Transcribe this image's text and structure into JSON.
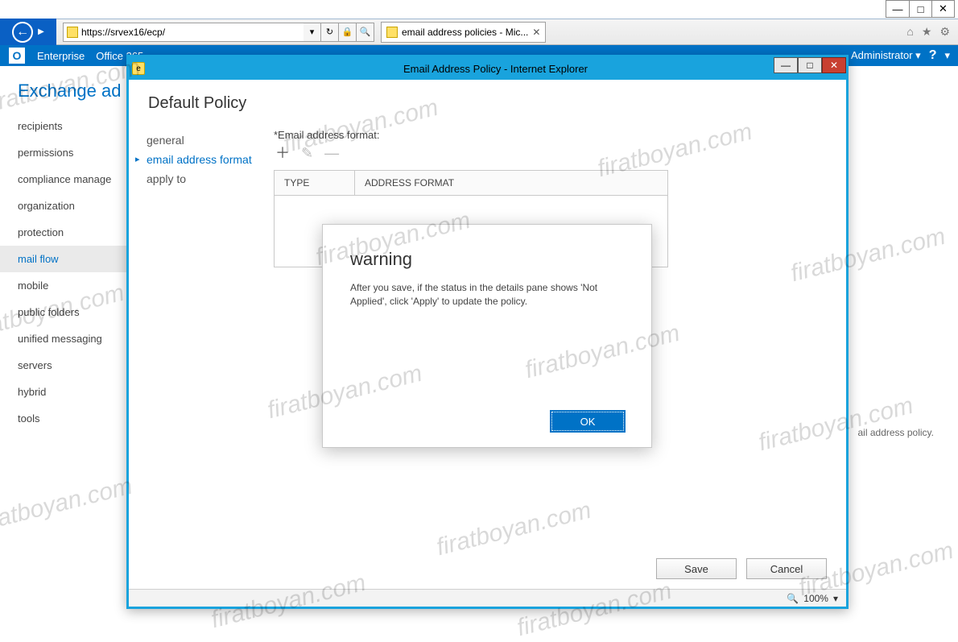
{
  "os_window": {
    "minimize": "—",
    "maximize": "□",
    "close": "✕"
  },
  "browser": {
    "url": "https://srvex16/ecp/",
    "tab_title": "email address policies - Mic...",
    "tools": {
      "home": "⌂",
      "star": "★",
      "gear": "⚙"
    }
  },
  "exchange_top": {
    "logo_letter": "O",
    "links": [
      "Enterprise",
      "Office 365"
    ],
    "user": "Administrator ▾",
    "help": "?",
    "help_caret": "▾"
  },
  "exchange_body": {
    "title": "Exchange ad",
    "nav": [
      "recipients",
      "permissions",
      "compliance manage",
      "organization",
      "protection",
      "mail flow",
      "mobile",
      "public folders",
      "unified messaging",
      "servers",
      "hybrid",
      "tools"
    ],
    "nav_active_index": 5,
    "right_hint": "ail address policy."
  },
  "popup": {
    "title": "Email Address Policy - Internet Explorer",
    "win": {
      "minimize": "—",
      "maximize": "□",
      "close": "✕"
    },
    "header": "Default Policy",
    "nav": [
      "general",
      "email address format",
      "apply to"
    ],
    "nav_active_index": 1,
    "field_label": "*Email address format:",
    "icons": {
      "add": "＋",
      "edit": "✎",
      "remove": "—"
    },
    "table": {
      "col1": "TYPE",
      "col2": "ADDRESS FORMAT"
    },
    "footer": {
      "save": "Save",
      "cancel": "Cancel"
    },
    "status": {
      "zoom": "100%",
      "caret": "▾"
    }
  },
  "warning": {
    "title": "warning",
    "message": "After you save, if the status in the details pane shows 'Not Applied', click 'Apply' to update the policy.",
    "ok": "OK"
  },
  "watermark": "firatboyan.com"
}
